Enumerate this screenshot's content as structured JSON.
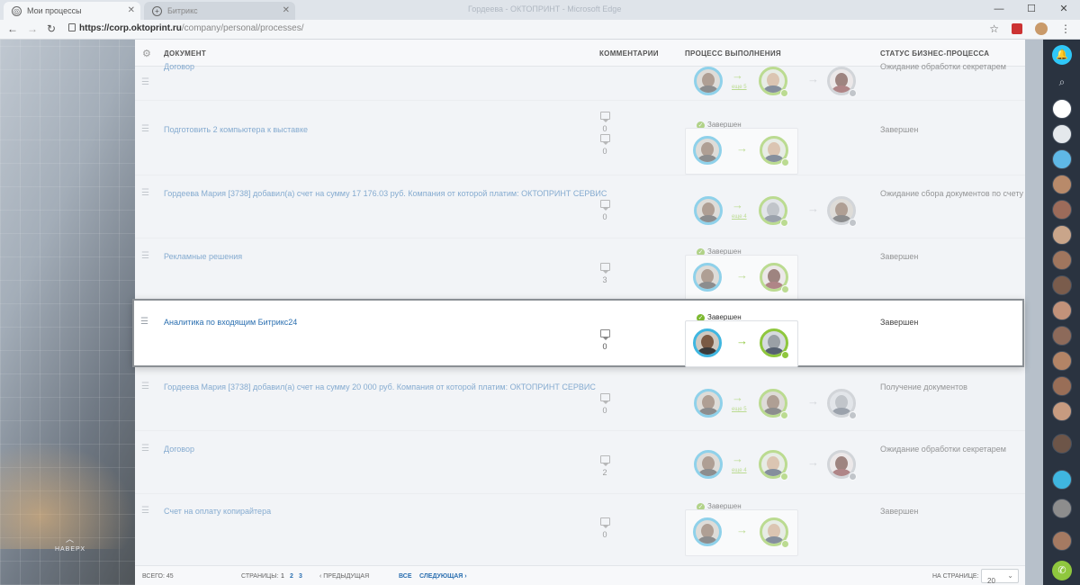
{
  "browser": {
    "active_tab": "Мои процессы",
    "inactive_tab": "Битрикс",
    "window_title": "Гордеева - ОКТОПРИНТ - Microsoft Edge",
    "url_host": "https://corp.oktoprint.ru",
    "url_path": "/company/personal/processes/"
  },
  "table": {
    "headers": {
      "document": "ДОКУМЕНТ",
      "comments": "КОММЕНТАРИИ",
      "process": "ПРОЦЕСС ВЫПОЛНЕНИЯ",
      "status": "СТАТУС БИЗНЕС-ПРОЦЕССА"
    },
    "rows": [
      {
        "document": "Договор",
        "comments": "0",
        "process_status": "",
        "step": "еще 5",
        "status": "Ожидание обработки секретарем"
      },
      {
        "document": "Подготовить 2 компьютера к выставке",
        "comments": "0",
        "process_status": "Завершен",
        "step": "",
        "status": "Завершен"
      },
      {
        "document": "Гордеева Мария [3738] добавил(а) счет на сумму 17 176.03 руб. Компания от которой платим: ОКТОПРИНТ СЕРВИС",
        "comments": "0",
        "process_status": "",
        "step": "еще 4",
        "status": "Ожидание сбора документов по счету"
      },
      {
        "document": "Рекламные решения",
        "comments": "3",
        "process_status": "Завершен",
        "step": "",
        "status": "Завершен"
      },
      {
        "document": "Аналитика по входящим Битрикс24",
        "comments": "0",
        "process_status": "Завершен",
        "step": "",
        "status": "Завершен"
      },
      {
        "document": "Гордеева Мария [3738] добавил(а) счет на сумму 20 000 руб. Компания от которой платим: ОКТОПРИНТ СЕРВИС",
        "comments": "0",
        "process_status": "",
        "step": "еще 5",
        "status": "Получение документов"
      },
      {
        "document": "Договор",
        "comments": "2",
        "process_status": "",
        "step": "еще 4",
        "status": "Ожидание обработки секретарем"
      },
      {
        "document": "Счет на оплату копирайтера",
        "comments": "0",
        "process_status": "Завершен",
        "step": "",
        "status": "Завершен"
      }
    ]
  },
  "footer": {
    "total": "ВСЕГО: 45",
    "pages_label": "СТРАНИЦЫ:",
    "page1": "1",
    "page2": "2",
    "page3": "3",
    "prev": "‹ ПРЕДЫДУЩАЯ",
    "all": "ВСЕ",
    "next": "СЛЕДУЮЩАЯ ›",
    "per_page_label": "НА СТРАНИЦЕ:",
    "per_page_value": "20"
  },
  "background": {
    "scroll_top_label": "НАВЕРХ"
  },
  "colors": {
    "accent_blue": "#3fb6e0",
    "done_green": "#8fc73e",
    "link": "#2b6fb0"
  }
}
